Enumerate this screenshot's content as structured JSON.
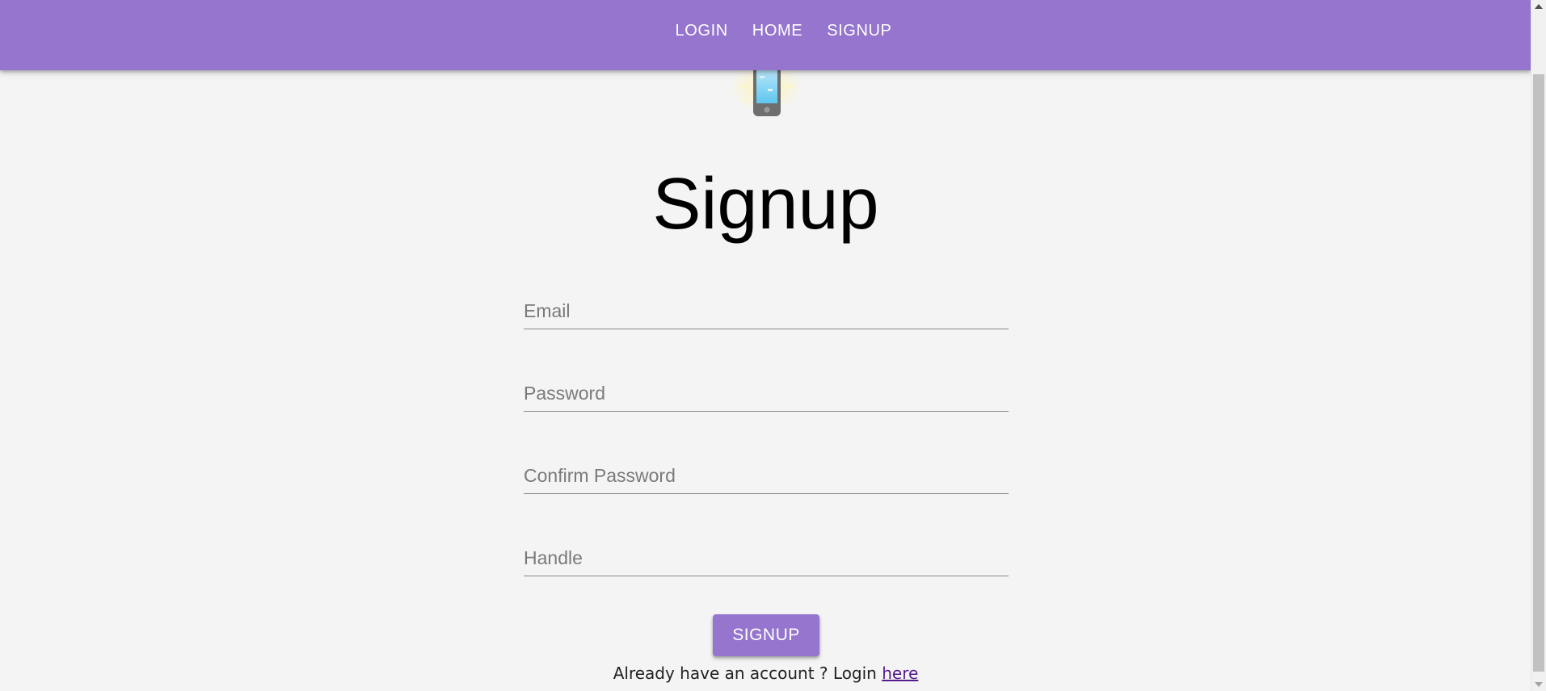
{
  "nav": {
    "items": [
      {
        "label": "LOGIN"
      },
      {
        "label": "HOME"
      },
      {
        "label": "SIGNUP"
      }
    ]
  },
  "logo": {
    "icon": "mobile-phone-icon"
  },
  "form": {
    "title": "Signup",
    "fields": [
      {
        "placeholder": "Email"
      },
      {
        "placeholder": "Password"
      },
      {
        "placeholder": "Confirm Password"
      },
      {
        "placeholder": "Handle"
      }
    ],
    "submit_label": "SIGNUP",
    "footer_text": "Already have an account ? Login ",
    "footer_link": "here"
  },
  "colors": {
    "primary": "#9575cd",
    "background": "#f4f4f4",
    "link": "#551a8b"
  }
}
